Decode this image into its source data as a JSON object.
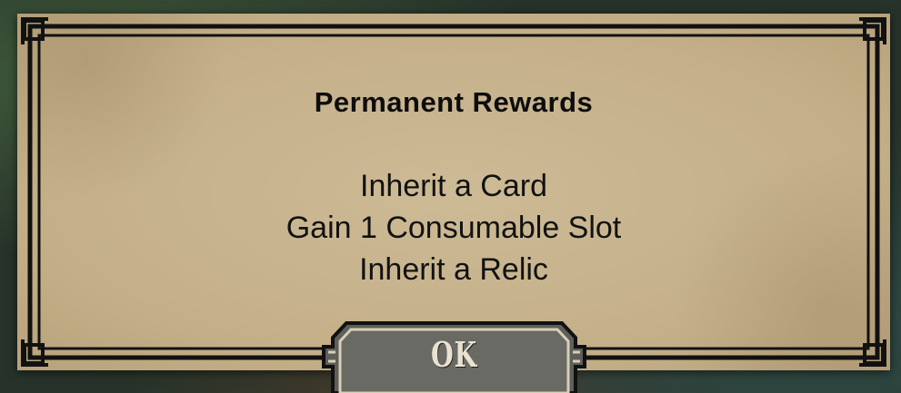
{
  "dialog": {
    "title": "Permanent Rewards",
    "rewards": [
      "Inherit a Card",
      "Gain 1 Consumable Slot",
      "Inherit a Relic"
    ],
    "ok_label": "OK"
  },
  "colors": {
    "parchment": "#c7b38d",
    "frame": "#111111",
    "button_fill": "#5e5e5a"
  }
}
